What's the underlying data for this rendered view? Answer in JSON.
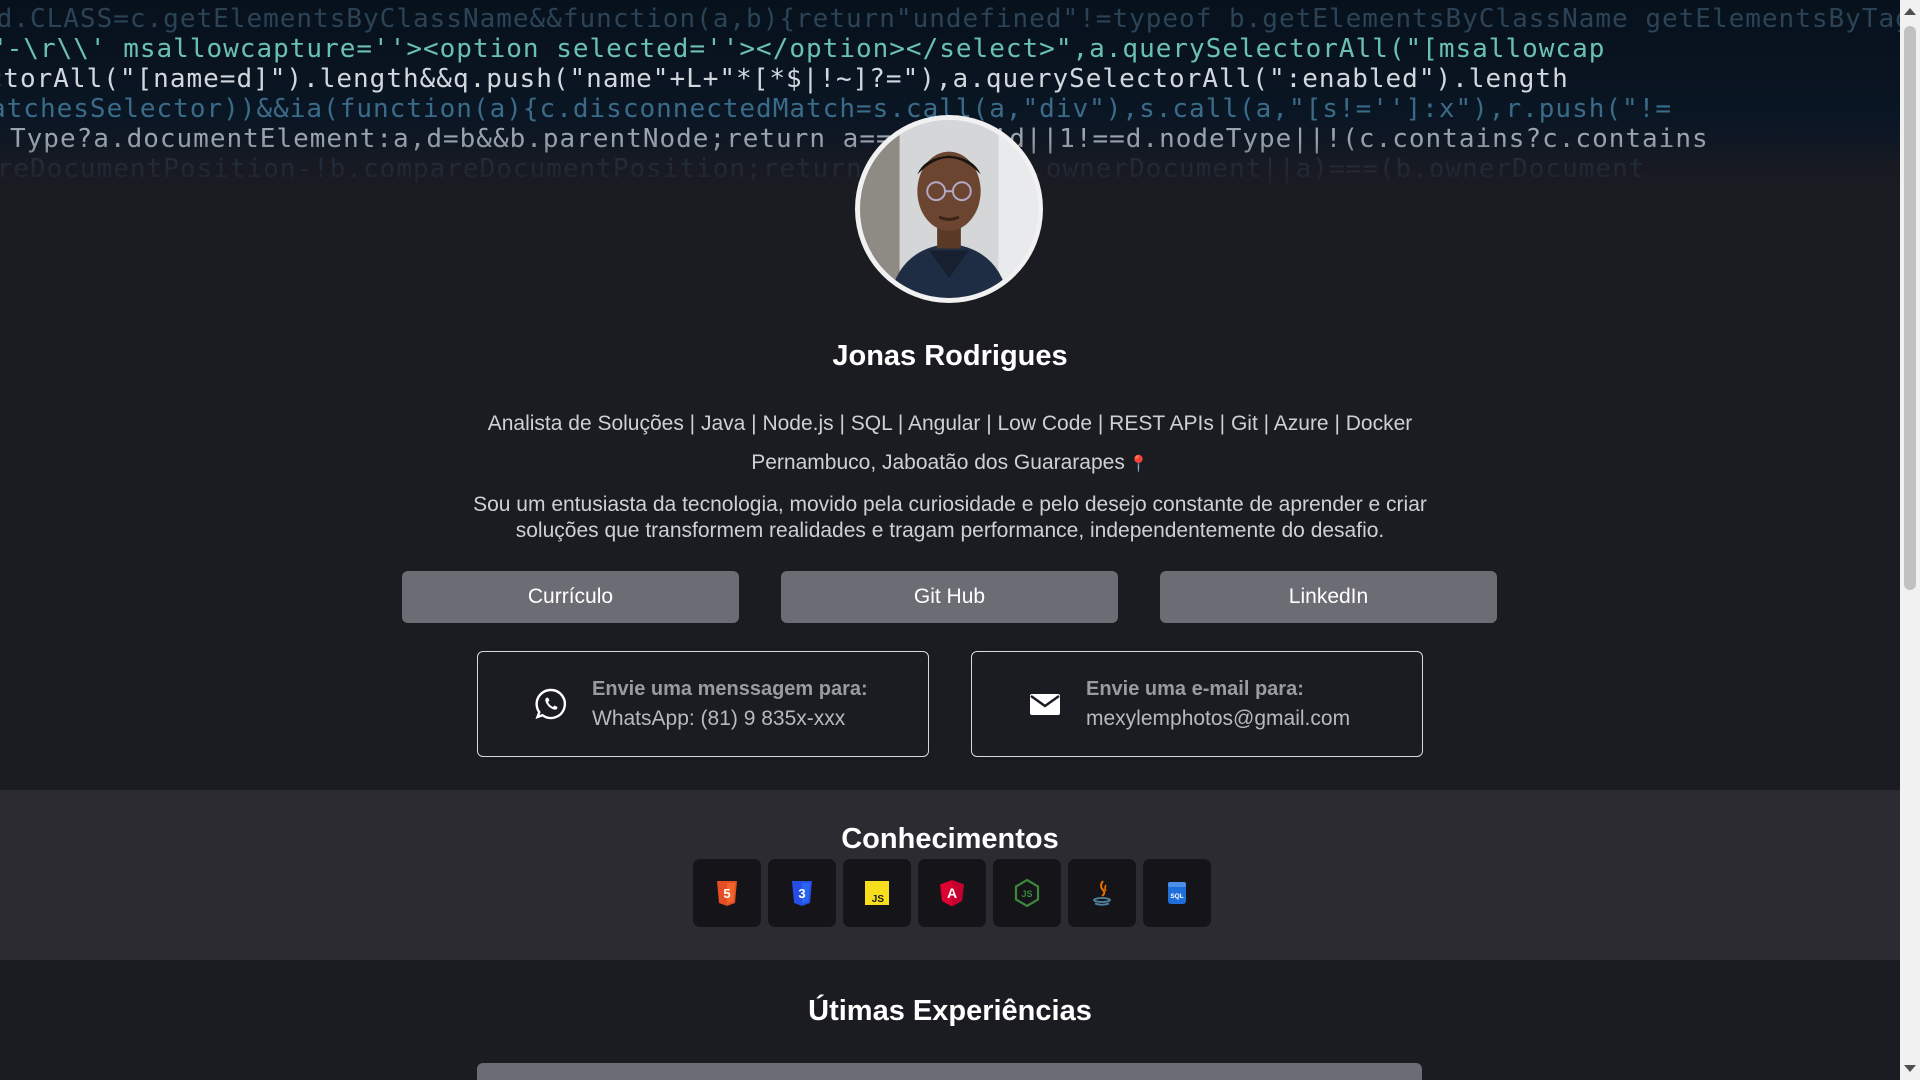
{
  "profile": {
    "name": "Jonas Rodrigues",
    "headline": "Analista de Soluções | Java | Node.js | SQL | Angular | Low Code | REST APIs | Git | Azure | Docker",
    "location": "Pernambuco, Jaboatão dos Guararapes",
    "location_icon": "pin-icon",
    "bio": "Sou um entusiasta da tecnologia, movido pela curiosidade e pelo desejo constante de aprender e criar soluções que transformem realidades e tragam performance, independentemente do desafio."
  },
  "buttons": {
    "resume": "Currículo",
    "github": "Git Hub",
    "linkedin": "LinkedIn"
  },
  "contacts": {
    "whatsapp": {
      "title": "Envie uma menssagem para:",
      "value": "WhatsApp: (81) 9 835x-xxx",
      "icon": "whatsapp-icon"
    },
    "email": {
      "title": "Envie uma e-mail para:",
      "value": "mexylemphotos@gmail.com",
      "icon": "mail-icon"
    }
  },
  "skills": {
    "title": "Conhecimentos",
    "items": [
      {
        "icon": "html5-icon",
        "label": "5",
        "color": "#e44d26"
      },
      {
        "icon": "css3-icon",
        "label": "3",
        "color": "#264de4"
      },
      {
        "icon": "javascript-icon",
        "label": "JS",
        "color": "#f7df1e"
      },
      {
        "icon": "angular-icon",
        "label": "A",
        "color": "#dd0031"
      },
      {
        "icon": "nodejs-icon",
        "label": "JS",
        "color": "#3c873a"
      },
      {
        "icon": "java-icon",
        "label": "",
        "color": "#e76f00"
      },
      {
        "icon": "sql-icon",
        "label": "SQL",
        "color": "#1e6fd9"
      }
    ]
  },
  "experience": {
    "title": "Útimas Experiências"
  },
  "banner_code": {
    "line1": "nd.CLASS=c.getElementsByClassName&&function(a,b){return\"undefined\"!=typeof b.getElementsByClassName getElementsByTagName querySe",
    "line2": "\"-\\r\\\\' msallowcapture=''><option selected=''></option></select>\",a.querySelectorAll(\"[msallowcap",
    "line3": "ectorAll(\"[name=d]\").length&&q.push(\"name\"+L+\"*[*$|!~]?=\"),a.querySelectorAll(\":enabled\").length",
    "line4": "atchesSelector))&&ia(function(a){c.disconnectedMatch=s.call(a,\"div\"),s.call(a,\"[s!='']:x\"),r.push(\"!=",
    "line5": "Type?a.documentElement:a,d=b&&b.parentNode;return a===d||!(!d||1!==d.nodeType||!(c.contains?c.contains",
    "line6": "areDocumentPosition-!b.compareDocumentPosition;return d?d:(d=(a.ownerDocument||a)===(b.ownerDocument"
  }
}
